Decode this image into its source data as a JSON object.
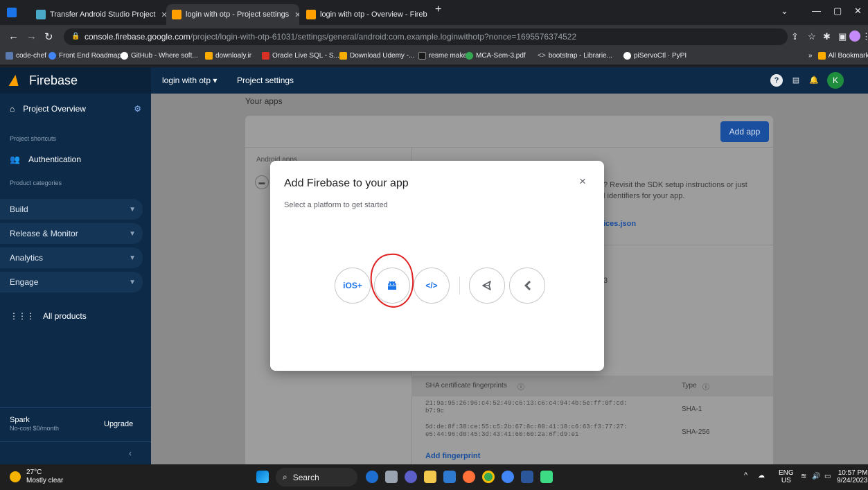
{
  "browser": {
    "tabs": [
      {
        "title": "Transfer Android Studio Project",
        "color": "#4ba9c8"
      },
      {
        "title": "login with otp - Project settings",
        "color": "#ffa000"
      },
      {
        "title": "login with otp - Overview - Fireb",
        "color": "#ffa000"
      }
    ],
    "url_host": "console.firebase.google.com",
    "url_path": "/project/login-with-otp-61031/settings/general/android:com.example.loginwithotp?nonce=1695576374522",
    "bookmarks": [
      "code-chef",
      "Front End Roadmap",
      "GitHub - Where soft...",
      "downloaly.ir",
      "Oracle Live SQL - S...",
      "Download Udemy -...",
      "resme maker",
      "MCA-Sem-3.pdf",
      "bootstrap - Librarie...",
      "piServoCtl · PyPI"
    ],
    "all_bookmarks": "All Bookmarks",
    "profile_initial": "K"
  },
  "sidebar": {
    "brand": "Firebase",
    "project_overview": "Project Overview",
    "shortcuts_label": "Project shortcuts",
    "authentication": "Authentication",
    "categories_label": "Product categories",
    "categories": [
      "Build",
      "Release & Monitor",
      "Analytics",
      "Engage"
    ],
    "all_products": "All products",
    "plan_name": "Spark",
    "plan_desc": "No-cost $0/month",
    "upgrade": "Upgrade"
  },
  "header": {
    "project": "login with otp",
    "page": "Project settings",
    "avatar": "K"
  },
  "main": {
    "your_apps": "Your apps",
    "add_app": "Add app",
    "android_apps": "Android apps",
    "sdk_text_1": "? Revisit the SDK setup instructions or just",
    "sdk_text_2": "l identifiers for your app.",
    "services_json": "ices.json",
    "partial_id": "3",
    "sha_header": "SHA certificate fingerprints",
    "type_header": "Type",
    "fingerprints": [
      {
        "line1": "21:9a:95:26:96:c4:52:49:c6:13:c6:c4:94:4b:5e:ff:0f:cd:",
        "line2": "b7:9c",
        "type": "SHA-1"
      },
      {
        "line1": "5d:de:8f:38:ce:55:c5:2b:67:8c:80:41:18:c6:63:f3:77:27:",
        "line2": "e5:44:96:d8:45:3d:43:41:60:60:2a:6f:d9:e1",
        "type": "SHA-256"
      }
    ],
    "add_fingerprint": "Add fingerprint"
  },
  "modal": {
    "title": "Add Firebase to your app",
    "subtitle": "Select a platform to get started",
    "close": "×",
    "platforms": [
      {
        "label": "iOS+",
        "icon": "ios-icon"
      },
      {
        "label": "android",
        "icon": "android-icon"
      },
      {
        "label": "</>",
        "icon": "web-icon"
      },
      {
        "label": "unity",
        "icon": "unity-icon"
      },
      {
        "label": "flutter",
        "icon": "flutter-icon"
      }
    ]
  },
  "taskbar": {
    "temp": "27°C",
    "weather": "Mostly clear",
    "search": "Search",
    "lang1": "ENG",
    "lang2": "US",
    "time": "10:57 PM",
    "date": "9/24/2023"
  }
}
